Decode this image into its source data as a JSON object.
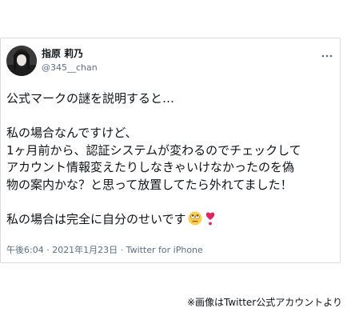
{
  "tweet": {
    "author": {
      "display_name": "指原 莉乃",
      "handle": "@345__chan"
    },
    "body_lines": [
      "公式マークの謎を説明すると…",
      "",
      "私の場合なんですけど、",
      "1ヶ月前から、認証システムが変わるのでチェックして",
      "アカウント情報変えたりしなきゃいけなかったのを偽",
      "物の案内かな？と思って放置してたら外れてました！",
      "",
      "私の場合は完全に自分のせいです"
    ],
    "emojis": [
      "rolling-eyes-face-emoji",
      "red-heart-exclamation-emoji"
    ],
    "meta": "午後6:04 · 2021年1月23日 · Twitter for iPhone"
  },
  "caption": "※画像はTwitter公式アカウントより",
  "colors": {
    "text": "#0f1419",
    "secondary": "#5b7083",
    "border": "#d7dbdf",
    "heart": "#e0245e",
    "face": "#ffcc4d"
  }
}
